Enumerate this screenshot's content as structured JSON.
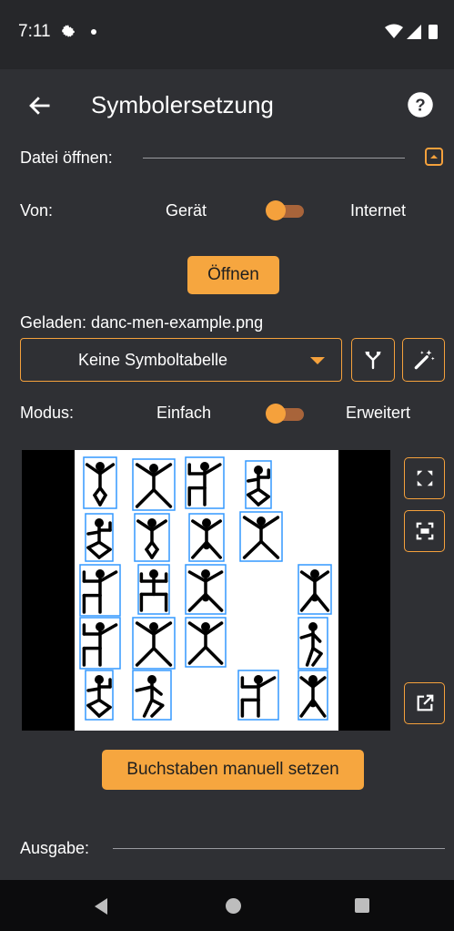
{
  "status_bar": {
    "time": "7:11"
  },
  "app_bar": {
    "title": "Symbolersetzung"
  },
  "file_section": {
    "label": "Datei öffnen:"
  },
  "source": {
    "label": "Von:",
    "option_left": "Gerät",
    "option_right": "Internet"
  },
  "open_button": {
    "label": "Öffnen"
  },
  "loaded": {
    "text": "Geladen: danc-men-example.png"
  },
  "symbol_table": {
    "selected": "Keine Symboltabelle"
  },
  "mode": {
    "label": "Modus:",
    "option_left": "Einfach",
    "option_right": "Erweitert"
  },
  "manual_button": {
    "label": "Buchstaben manuell setzen"
  },
  "output_section": {
    "label": "Ausgabe:"
  },
  "colors": {
    "accent": "#f6a63f",
    "background": "#2f3034",
    "box": "#3399ff"
  }
}
